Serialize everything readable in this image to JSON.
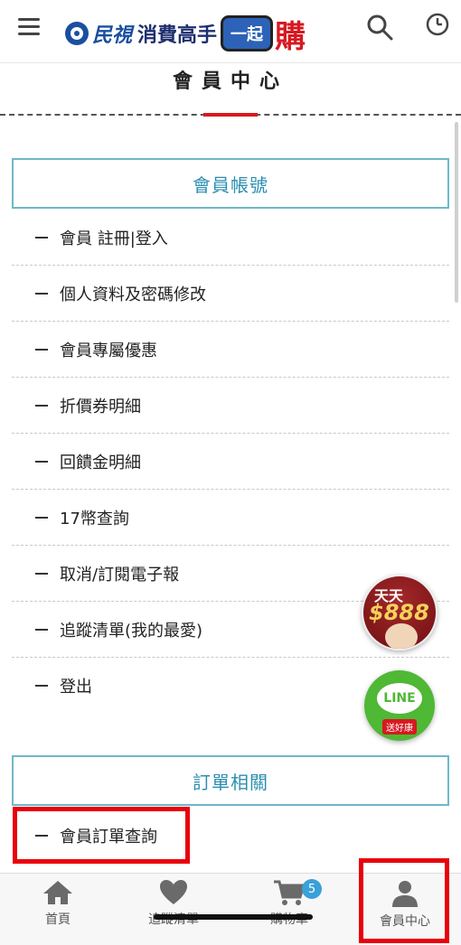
{
  "header": {
    "logo_brand": "民視",
    "logo_sub": "消費高手",
    "logo_tv": "一起",
    "logo_buy": "購"
  },
  "page": {
    "title": "會員中心"
  },
  "sections": [
    {
      "heading": "會員帳號",
      "items": [
        "會員 註冊|登入",
        "個人資料及密碼修改",
        "會員專屬優惠",
        "折價券明細",
        "回饋金明細",
        "17幣查詢",
        "取消/訂閱電子報",
        "追蹤清單(我的最愛)",
        "登出"
      ]
    },
    {
      "heading": "訂單相關",
      "items": [
        "會員訂單查詢"
      ]
    }
  ],
  "floating": {
    "promo_line1": "天天",
    "promo_line2": "$888",
    "line_label": "LINE",
    "line_tag": "送好康"
  },
  "bottom_nav": {
    "items": [
      {
        "label": "首頁",
        "icon": "home-icon"
      },
      {
        "label": "追蹤清單",
        "icon": "heart-icon"
      },
      {
        "label": "購物車",
        "icon": "cart-icon",
        "badge": "5"
      },
      {
        "label": "會員中心",
        "icon": "user-icon"
      }
    ]
  },
  "colors": {
    "accent_red": "#d71921",
    "section_border": "#6fb7c9",
    "section_text": "#2b8fb0",
    "highlight": "#e8000b"
  }
}
